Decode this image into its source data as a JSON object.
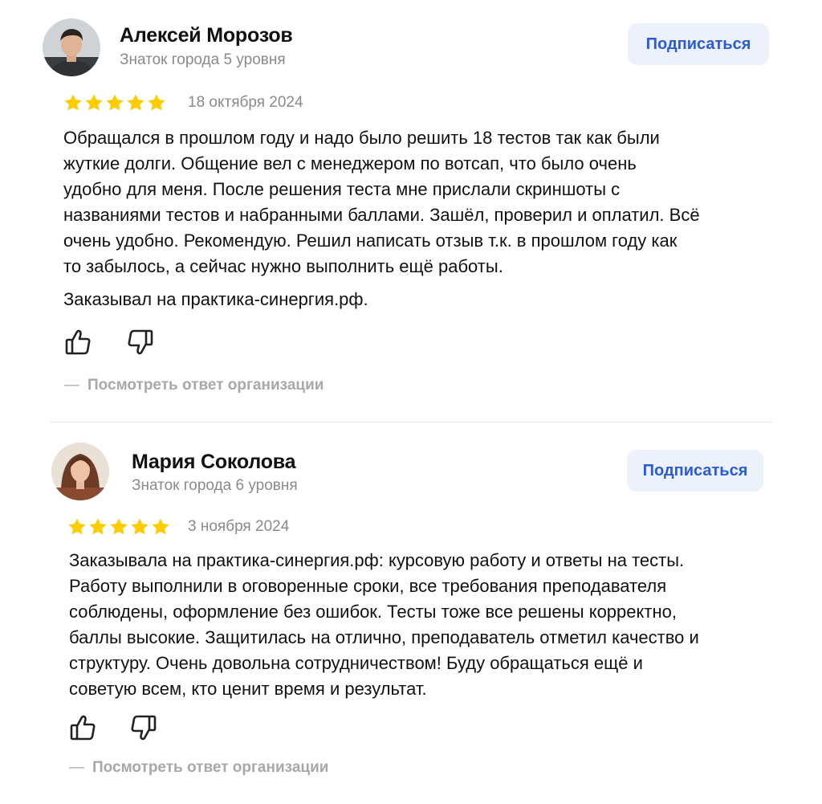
{
  "reviews": [
    {
      "author": "Алексей Морозов",
      "level": "Знаток города 5 уровня",
      "subscribe_label": "Подписаться",
      "rating": 5,
      "date": "18 октября 2024",
      "text_lines": [
        "Обращался в прошлом году и надо было решить 18 тестов так как были",
        "жуткие долги. Общение вел с менеджером по вотсап, что было очень",
        "удобно для меня. После решения теста мне прислали скриншоты с",
        "названиями тестов и набранными баллами. Зашёл, проверил и оплатил. Всё",
        "очень удобно. Рекомендую. Решил написать отзыв т.к. в прошлом году как",
        "то забылось, а сейчас нужно выполнить ещё работы."
      ],
      "text_extra": "Заказывал на практика-синергия.рф.",
      "like_icon": "thumbs-up-icon",
      "dislike_icon": "thumbs-down-icon",
      "org_reply_dash": "—",
      "org_reply_label": "Посмотреть ответ организации"
    },
    {
      "author": "Мария Соколова",
      "level": "Знаток города 6 уровня",
      "subscribe_label": "Подписаться",
      "rating": 5,
      "date": "3 ноября 2024",
      "text_lines": [
        "Заказывала на практика-синергия.рф: курсовую работу и ответы на тесты.",
        "Работу выполнили в оговоренные сроки, все требования преподавателя",
        "соблюдены, оформление без ошибок. Тесты тоже все решены корректно,",
        "баллы высокие. Защитилась на отлично, преподаватель отметил качество и",
        "структуру. Очень довольна сотрудничеством! Буду обращаться ещё и",
        "советую всем, кто ценит время и результат."
      ],
      "like_icon": "thumbs-up-icon",
      "dislike_icon": "thumbs-down-icon",
      "org_reply_dash": "—",
      "org_reply_label": "Посмотреть ответ организации"
    }
  ],
  "colors": {
    "star": "#ffcc00",
    "accent": "#2b5bd7",
    "button_bg": "#ecf1fb",
    "muted": "#8a8a8a"
  }
}
